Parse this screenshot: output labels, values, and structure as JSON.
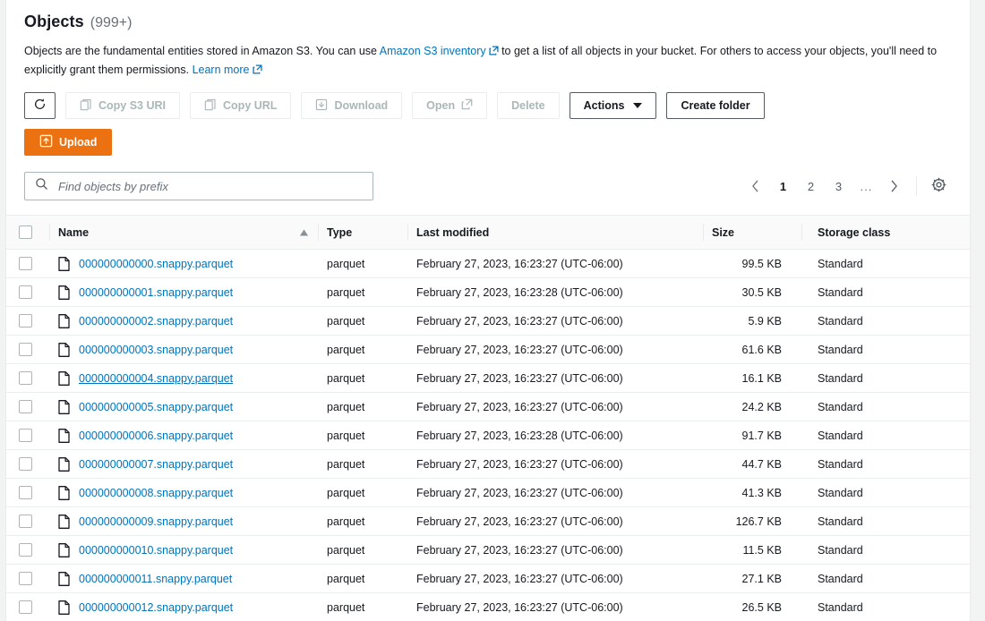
{
  "header": {
    "title": "Objects",
    "count": "(999+)",
    "description_part1": "Objects are the fundamental entities stored in Amazon S3. You can use ",
    "inventory_link": "Amazon S3 inventory",
    "description_part2": " to get a list of all objects in your bucket. For others to access your objects, you'll need to explicitly grant them permissions. ",
    "learn_more_link": "Learn more"
  },
  "toolbar": {
    "refresh_label": "",
    "refresh_icon": "refresh-icon",
    "copy_s3_uri_label": "Copy S3 URI",
    "copy_url_label": "Copy URL",
    "download_label": "Download",
    "open_label": "Open",
    "delete_label": "Delete",
    "actions_label": "Actions",
    "create_folder_label": "Create folder",
    "upload_label": "Upload"
  },
  "filter": {
    "search_placeholder": "Find objects by prefix",
    "search_value": "",
    "search_icon": "search-icon"
  },
  "pagination": {
    "prev_label": "‹",
    "next_label": "›",
    "pages": [
      "1",
      "2",
      "3"
    ],
    "active_page": "1",
    "ellipsis": "...",
    "settings_icon": "gear-icon"
  },
  "table": {
    "columns": [
      {
        "key": "name",
        "label": "Name"
      },
      {
        "key": "type",
        "label": "Type"
      },
      {
        "key": "modified",
        "label": "Last modified"
      },
      {
        "key": "size",
        "label": "Size"
      },
      {
        "key": "storage",
        "label": "Storage class"
      }
    ],
    "sort_column": "Name",
    "sort_direction": "asc",
    "rows": [
      {
        "name": "000000000000.snappy.parquet",
        "type": "parquet",
        "modified": "February 27, 2023, 16:23:27 (UTC-06:00)",
        "size": "99.5 KB",
        "storage": "Standard",
        "hovered": false
      },
      {
        "name": "000000000001.snappy.parquet",
        "type": "parquet",
        "modified": "February 27, 2023, 16:23:28 (UTC-06:00)",
        "size": "30.5 KB",
        "storage": "Standard",
        "hovered": false
      },
      {
        "name": "000000000002.snappy.parquet",
        "type": "parquet",
        "modified": "February 27, 2023, 16:23:27 (UTC-06:00)",
        "size": "5.9 KB",
        "storage": "Standard",
        "hovered": false
      },
      {
        "name": "000000000003.snappy.parquet",
        "type": "parquet",
        "modified": "February 27, 2023, 16:23:27 (UTC-06:00)",
        "size": "61.6 KB",
        "storage": "Standard",
        "hovered": false
      },
      {
        "name": "000000000004.snappy.parquet",
        "type": "parquet",
        "modified": "February 27, 2023, 16:23:27 (UTC-06:00)",
        "size": "16.1 KB",
        "storage": "Standard",
        "hovered": true
      },
      {
        "name": "000000000005.snappy.parquet",
        "type": "parquet",
        "modified": "February 27, 2023, 16:23:27 (UTC-06:00)",
        "size": "24.2 KB",
        "storage": "Standard",
        "hovered": false
      },
      {
        "name": "000000000006.snappy.parquet",
        "type": "parquet",
        "modified": "February 27, 2023, 16:23:28 (UTC-06:00)",
        "size": "91.7 KB",
        "storage": "Standard",
        "hovered": false
      },
      {
        "name": "000000000007.snappy.parquet",
        "type": "parquet",
        "modified": "February 27, 2023, 16:23:27 (UTC-06:00)",
        "size": "44.7 KB",
        "storage": "Standard",
        "hovered": false
      },
      {
        "name": "000000000008.snappy.parquet",
        "type": "parquet",
        "modified": "February 27, 2023, 16:23:27 (UTC-06:00)",
        "size": "41.3 KB",
        "storage": "Standard",
        "hovered": false
      },
      {
        "name": "000000000009.snappy.parquet",
        "type": "parquet",
        "modified": "February 27, 2023, 16:23:27 (UTC-06:00)",
        "size": "126.7 KB",
        "storage": "Standard",
        "hovered": false
      },
      {
        "name": "000000000010.snappy.parquet",
        "type": "parquet",
        "modified": "February 27, 2023, 16:23:27 (UTC-06:00)",
        "size": "11.5 KB",
        "storage": "Standard",
        "hovered": false
      },
      {
        "name": "000000000011.snappy.parquet",
        "type": "parquet",
        "modified": "February 27, 2023, 16:23:27 (UTC-06:00)",
        "size": "27.1 KB",
        "storage": "Standard",
        "hovered": false
      },
      {
        "name": "000000000012.snappy.parquet",
        "type": "parquet",
        "modified": "February 27, 2023, 16:23:27 (UTC-06:00)",
        "size": "26.5 KB",
        "storage": "Standard",
        "hovered": false
      }
    ]
  },
  "colors": {
    "link": "#0073bb",
    "primary": "#ec7211",
    "text": "#16191f",
    "muted": "#687078",
    "disabled": "#aab7b8",
    "border": "#eaeded",
    "header_bg": "#fafafa",
    "page_bg": "#f2f3f3"
  }
}
